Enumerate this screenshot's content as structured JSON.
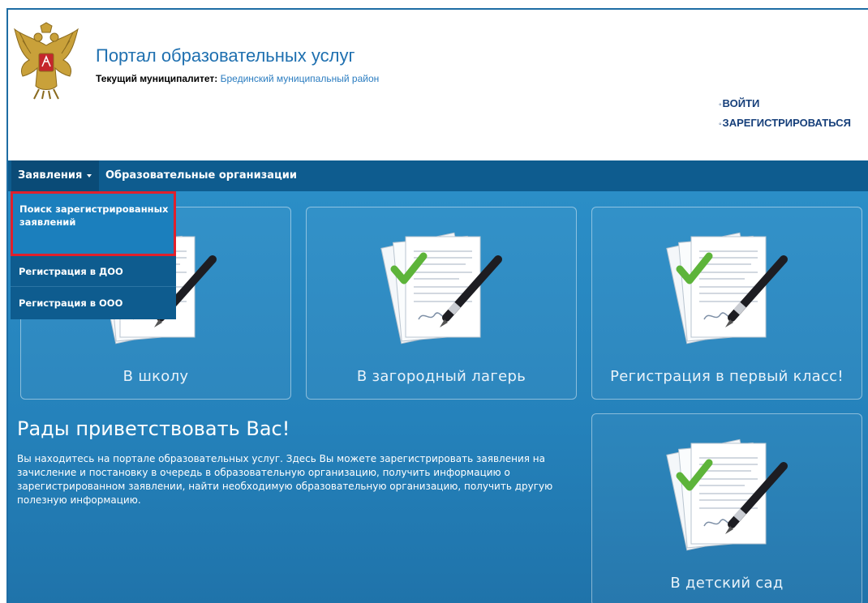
{
  "header": {
    "title": "Портал образовательных услуг",
    "municipality_label": "Текущий муниципалитет:",
    "municipality_value": "Брединский муниципальный район",
    "auth": {
      "login": "ВОЙТИ",
      "register": "ЗАРЕГИСТРИРОВАТЬСЯ"
    }
  },
  "nav": {
    "applications": "Заявления",
    "organizations": "Образовательные организации"
  },
  "dropdown": {
    "items": [
      "Поиск зарегистрированных заявлений",
      "Регистрация в ДОО",
      "Регистрация в ООО"
    ]
  },
  "cards": {
    "school": "В школу",
    "camp": "В загородный лагерь",
    "first_grade": "Регистрация в первый класс!",
    "kindergarten": "В детский сад"
  },
  "welcome": {
    "title": "Рады приветствовать Вас!",
    "text": "Вы находитесь на портале образовательных услуг. Здесь Вы можете зарегистрировать заявления на зачисление и постановку в очередь в образовательную организацию, получить информацию о зарегистрированном заявлении, найти необходимую образовательную организацию, получить другую полезную информацию."
  },
  "colors": {
    "brand_blue": "#1f70b0",
    "navbar": "#0e5c8f",
    "highlight_border": "#e0202c"
  }
}
